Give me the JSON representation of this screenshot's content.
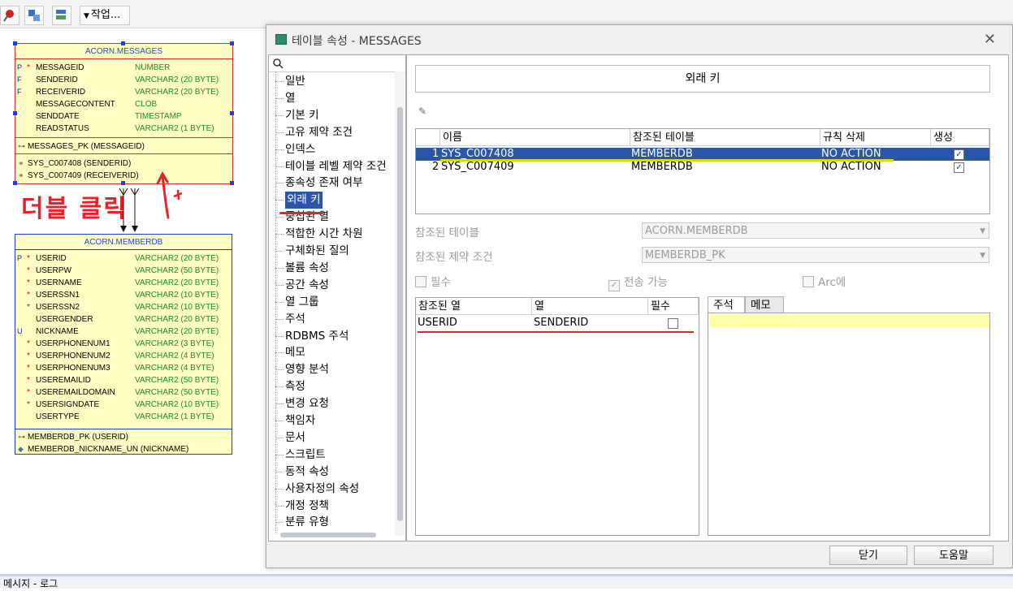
{
  "toolbar": {
    "action_menu_label": "작업..."
  },
  "diagram": {
    "messages_table": {
      "title": "ACORN.MESSAGES",
      "columns": [
        {
          "key": "P",
          "req": "*",
          "name": "MESSAGEID",
          "type": "NUMBER"
        },
        {
          "key": "F",
          "req": "",
          "name": "SENDERID",
          "type": "VARCHAR2 (20 BYTE)"
        },
        {
          "key": "F",
          "req": "",
          "name": "RECEIVERID",
          "type": "VARCHAR2 (20 BYTE)"
        },
        {
          "key": "",
          "req": "",
          "name": "MESSAGECONTENT",
          "type": "CLOB"
        },
        {
          "key": "",
          "req": "",
          "name": "SENDDATE",
          "type": "TIMESTAMP"
        },
        {
          "key": "",
          "req": "",
          "name": "READSTATUS",
          "type": "VARCHAR2 (1 BYTE)"
        }
      ],
      "pk": "MESSAGES_PK (MESSAGEID)",
      "fks": [
        "SYS_C007408 (SENDERID)",
        "SYS_C007409 (RECEIVERID)"
      ]
    },
    "memberdb_table": {
      "title": "ACORN.MEMBERDB",
      "columns": [
        {
          "key": "P",
          "req": "*",
          "name": "USERID",
          "type": "VARCHAR2 (20 BYTE)"
        },
        {
          "key": "",
          "req": "*",
          "name": "USERPW",
          "type": "VARCHAR2 (50 BYTE)"
        },
        {
          "key": "",
          "req": "*",
          "name": "USERNAME",
          "type": "VARCHAR2 (20 BYTE)"
        },
        {
          "key": "",
          "req": "*",
          "name": "USERSSN1",
          "type": "VARCHAR2 (10 BYTE)"
        },
        {
          "key": "",
          "req": "*",
          "name": "USERSSN2",
          "type": "VARCHAR2 (10 BYTE)"
        },
        {
          "key": "",
          "req": "",
          "name": "USERGENDER",
          "type": "VARCHAR2 (20 BYTE)"
        },
        {
          "key": "U",
          "req": "",
          "name": "NICKNAME",
          "type": "VARCHAR2 (20 BYTE)"
        },
        {
          "key": "",
          "req": "*",
          "name": "USERPHONENUM1",
          "type": "VARCHAR2 (3 BYTE)"
        },
        {
          "key": "",
          "req": "*",
          "name": "USERPHONENUM2",
          "type": "VARCHAR2 (4 BYTE)"
        },
        {
          "key": "",
          "req": "*",
          "name": "USERPHONENUM3",
          "type": "VARCHAR2 (4 BYTE)"
        },
        {
          "key": "",
          "req": "*",
          "name": "USEREMAILID",
          "type": "VARCHAR2 (50 BYTE)"
        },
        {
          "key": "",
          "req": "*",
          "name": "USEREMAILDOMAIN",
          "type": "VARCHAR2 (50 BYTE)"
        },
        {
          "key": "",
          "req": "*",
          "name": "USERSIGNDATE",
          "type": "VARCHAR2 (10 BYTE)"
        },
        {
          "key": "",
          "req": "",
          "name": "USERTYPE",
          "type": "VARCHAR2 (1 BYTE)"
        }
      ],
      "pk": "MEMBERDB_PK (USERID)",
      "uk": "MEMBERDB_NICKNAME_UN (NICKNAME)"
    },
    "annotation": "더블 클릭",
    "colors": {
      "annotation": "#e8202a",
      "table_fill": "#ffffc4"
    }
  },
  "dialog": {
    "title": "테이블 속성 - MESSAGES",
    "nav_items": [
      "일반",
      "열",
      "기본 키",
      "고유 제약 조건",
      "인덱스",
      "테이블 레벨 제약 조건",
      "종속성 존재 여부",
      "외래 키",
      "중첩된 열",
      "적합한 시간 차원",
      "구체화된 질의",
      "볼륨 속성",
      "공간 속성",
      "열 그룹",
      "주석",
      "RDBMS 주석",
      "메모",
      "영향 분석",
      "측정",
      "변경 요청",
      "책임자",
      "문서",
      "스크립트",
      "동적 속성",
      "사용자정의 속성",
      "개정 정책",
      "분류 유형"
    ],
    "selected_nav": "외래 키",
    "panel_title": "외래 키",
    "fk_table": {
      "headers": [
        "이름",
        "참조된 테이블",
        "규칙 삭제",
        "생성"
      ],
      "rows": [
        {
          "num": "1",
          "name": "SYS_C007408",
          "ref": "MEMBERDB",
          "rule": "NO ACTION",
          "gen": "✓"
        },
        {
          "num": "2",
          "name": "SYS_C007409",
          "ref": "MEMBERDB",
          "rule": "NO ACTION",
          "gen": "✓"
        }
      ]
    },
    "referenced_table_label": "참조된 테이블",
    "referenced_table_value": "ACORN.MEMBERDB",
    "referenced_constraint_label": "참조된 제약 조건",
    "referenced_constraint_value": "MEMBERDB_PK",
    "checkbox_required": "필수",
    "checkbox_transferable": "전송 가능",
    "checkbox_arc": "Arc에",
    "col_table": {
      "headers": [
        "참조된 열",
        "열",
        "필수"
      ],
      "rows": [
        {
          "ref": "USERID",
          "col": "SENDERID"
        }
      ]
    },
    "tabs": [
      "주석",
      "메모"
    ],
    "close_button": "닫기",
    "help_button": "도움말"
  },
  "statusbar": {
    "text": "메시지 - 로그"
  }
}
